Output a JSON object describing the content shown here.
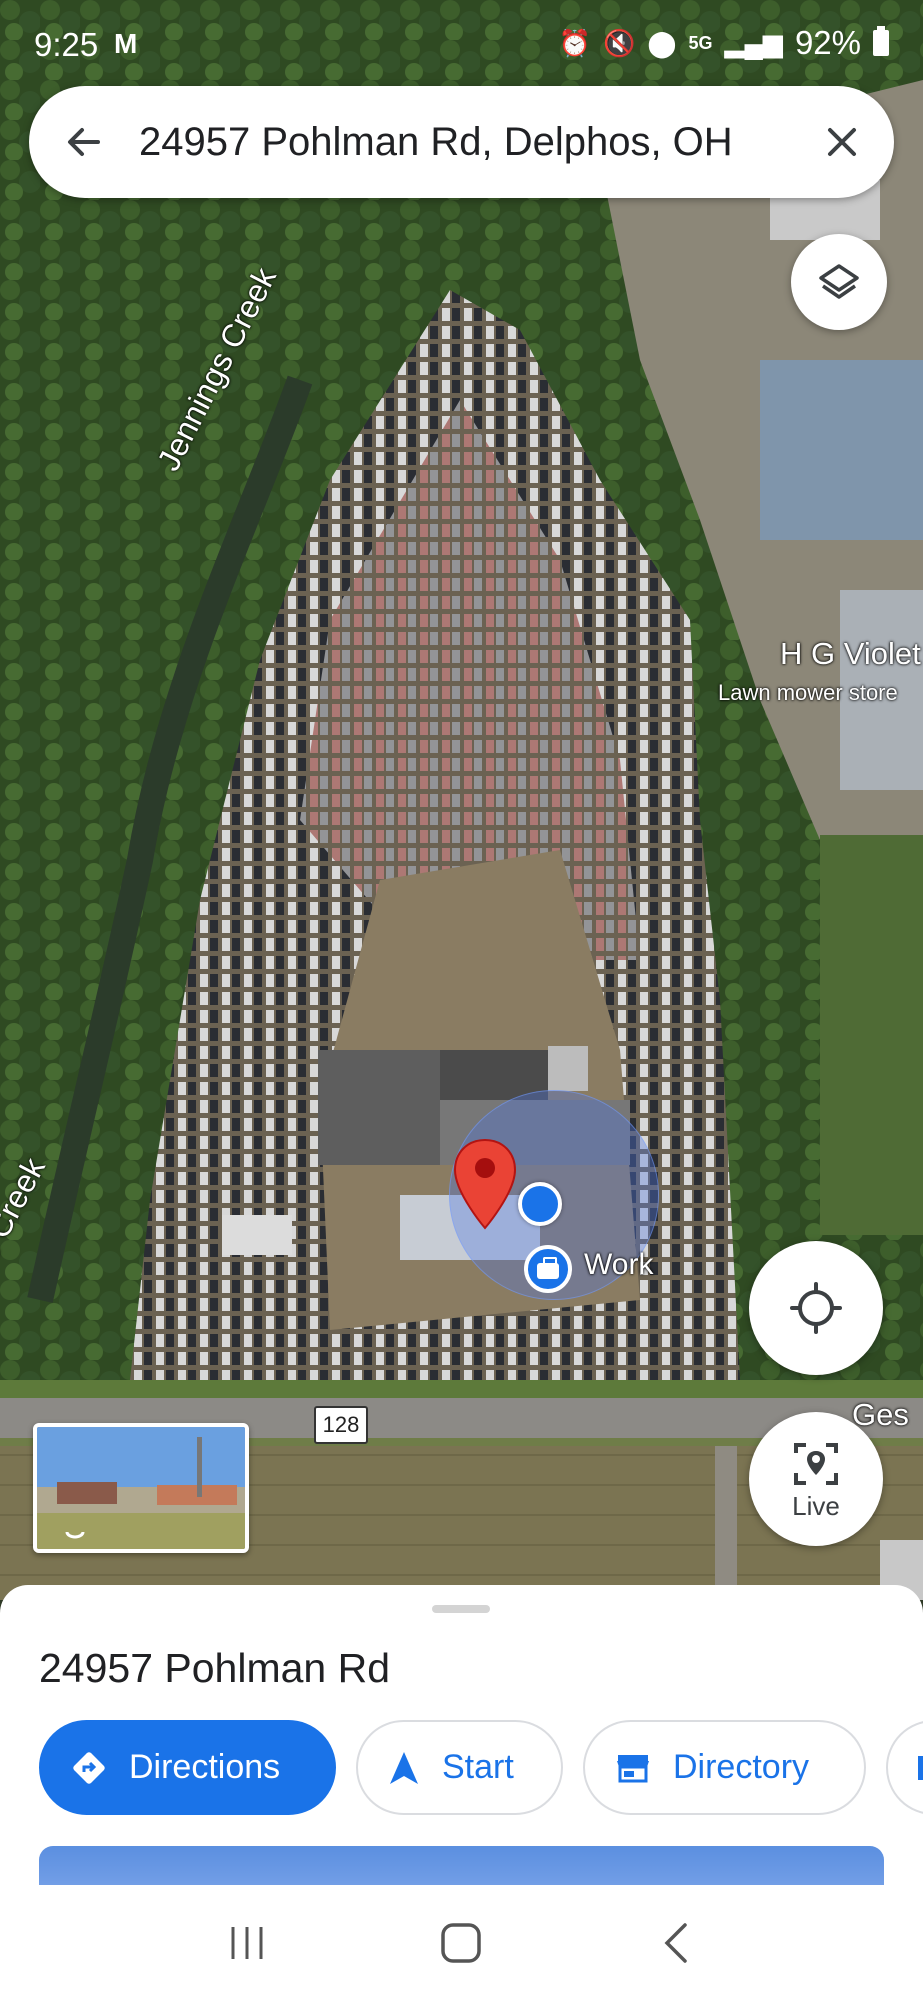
{
  "status_bar": {
    "time": "9:25",
    "battery": "92%",
    "icons": [
      "gmail-icon",
      "alarm-icon",
      "mute-icon",
      "location-icon",
      "5g-icon",
      "signal-icon",
      "battery-icon"
    ]
  },
  "search": {
    "query": "24957 Pohlman Rd, Delphos, OH",
    "back_icon": "arrow-back-icon",
    "close_icon": "close-icon"
  },
  "map": {
    "labels": {
      "creek_upper": "Jennings Creek",
      "creek_lower": "gs Creek",
      "poi_name": "H G Violet",
      "poi_category": "Lawn mower store",
      "road_partial": "Ges",
      "route_number": "128",
      "work_label": "Work"
    },
    "buttons": {
      "layers_icon": "layers-icon",
      "locate_icon": "my-location-icon",
      "live_label": "Live"
    }
  },
  "place": {
    "title": "24957 Pohlman Rd",
    "actions": [
      {
        "label": "Directions",
        "icon": "directions-icon"
      },
      {
        "label": "Start",
        "icon": "navigation-arrow-icon"
      },
      {
        "label": "Directory",
        "icon": "store-icon"
      }
    ]
  },
  "nav_bar": {
    "buttons": [
      "recent-apps-icon",
      "home-icon",
      "back-icon"
    ]
  },
  "colors": {
    "accent": "#1a73e8",
    "pin_red": "#ea4335",
    "grass": "#3b5a2a"
  }
}
